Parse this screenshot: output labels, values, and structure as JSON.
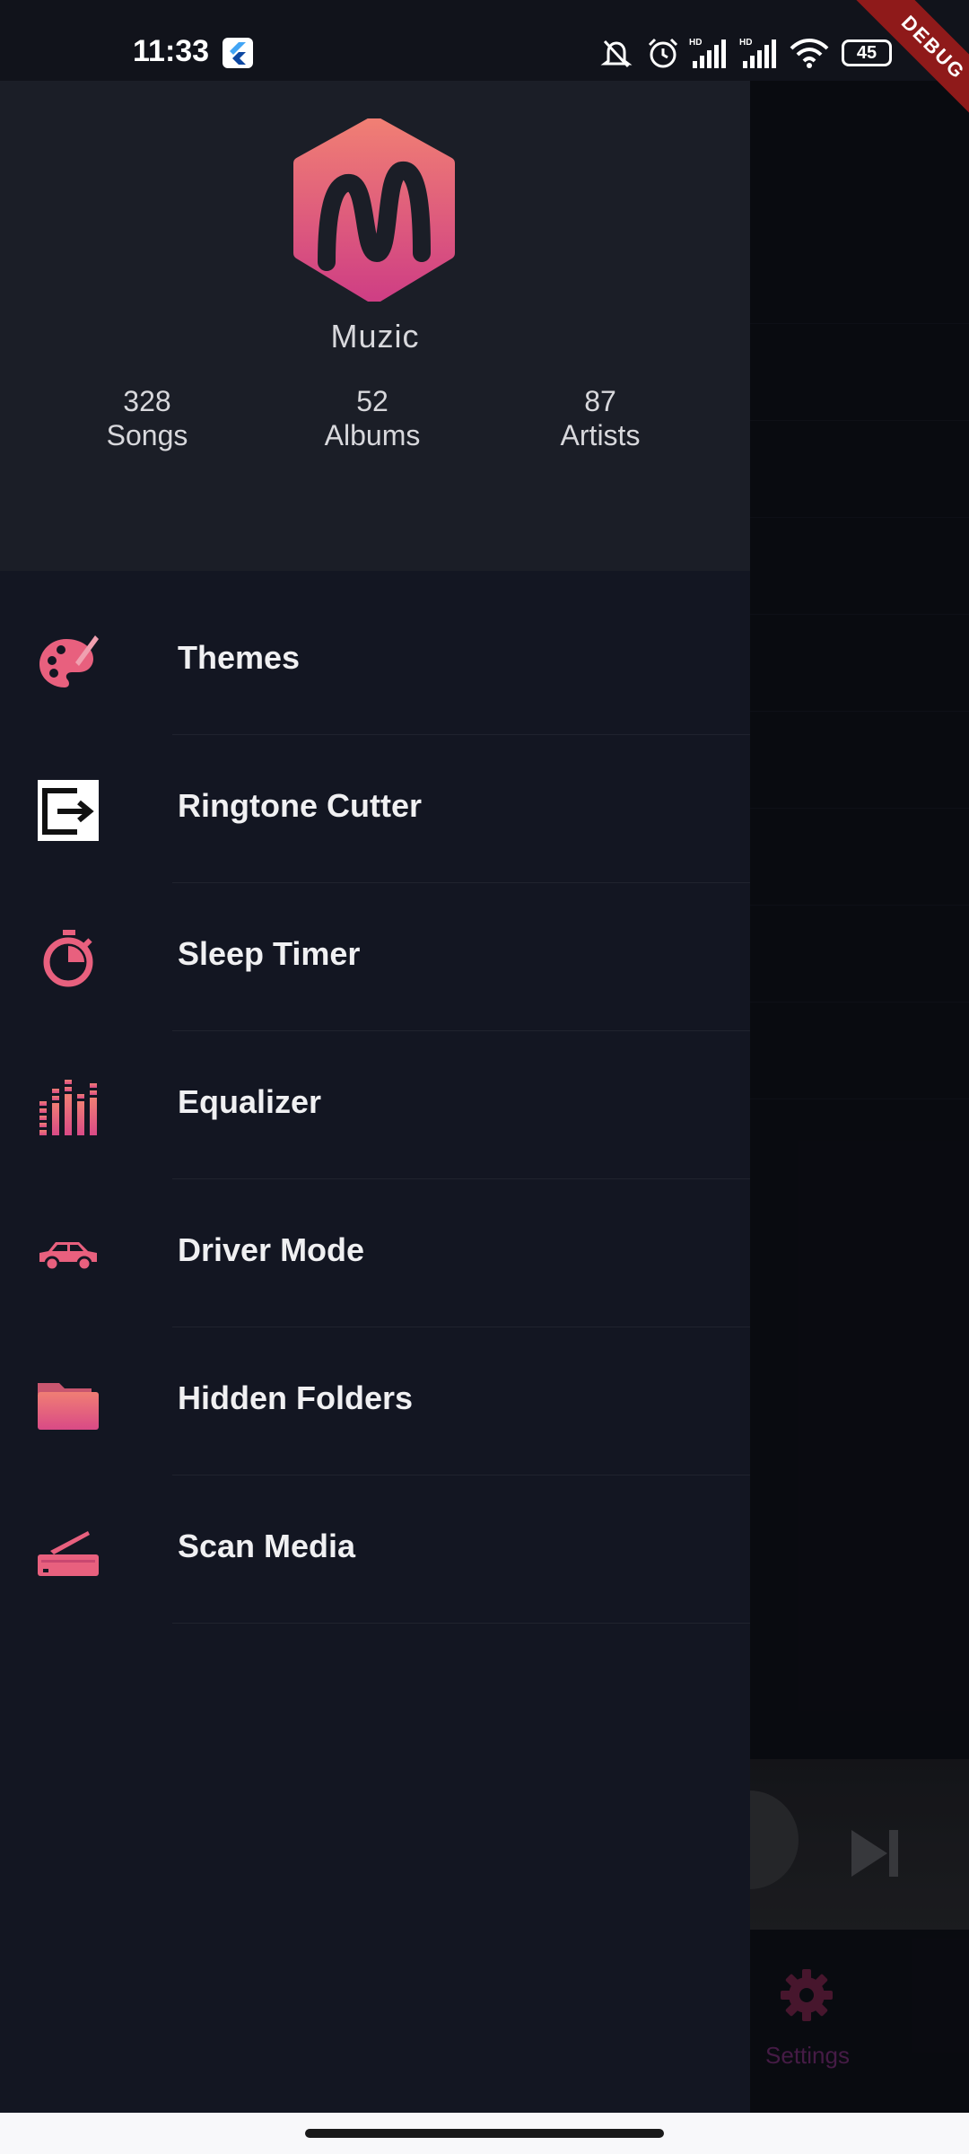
{
  "status_bar": {
    "time": "11:33",
    "battery": "45",
    "debug_ribbon": "DEBUG",
    "icons": [
      "flutter-icon",
      "mute-icon",
      "alarm-icon",
      "signal-hd-icon",
      "signal-hd-icon",
      "wifi-icon",
      "battery-icon"
    ]
  },
  "drawer": {
    "app_name": "Muzic",
    "stats": [
      {
        "count": "328",
        "label": "Songs"
      },
      {
        "count": "52",
        "label": "Albums"
      },
      {
        "count": "87",
        "label": "Artists"
      }
    ],
    "menu": [
      {
        "label": "Themes",
        "icon": "palette-icon"
      },
      {
        "label": "Ringtone Cutter",
        "icon": "exit-box-icon"
      },
      {
        "label": "Sleep Timer",
        "icon": "stopwatch-icon"
      },
      {
        "label": "Equalizer",
        "icon": "equalizer-icon"
      },
      {
        "label": "Driver Mode",
        "icon": "car-icon"
      },
      {
        "label": "Hidden Folders",
        "icon": "folder-icon"
      },
      {
        "label": "Scan Media",
        "icon": "scanner-icon"
      }
    ]
  },
  "background": {
    "settings_label": "Settings"
  },
  "colors": {
    "accent_pink": "#e8607e",
    "accent_gradient_end": "#d94a86",
    "drawer_bg": "#131622",
    "header_bg": "#1b1e27"
  }
}
